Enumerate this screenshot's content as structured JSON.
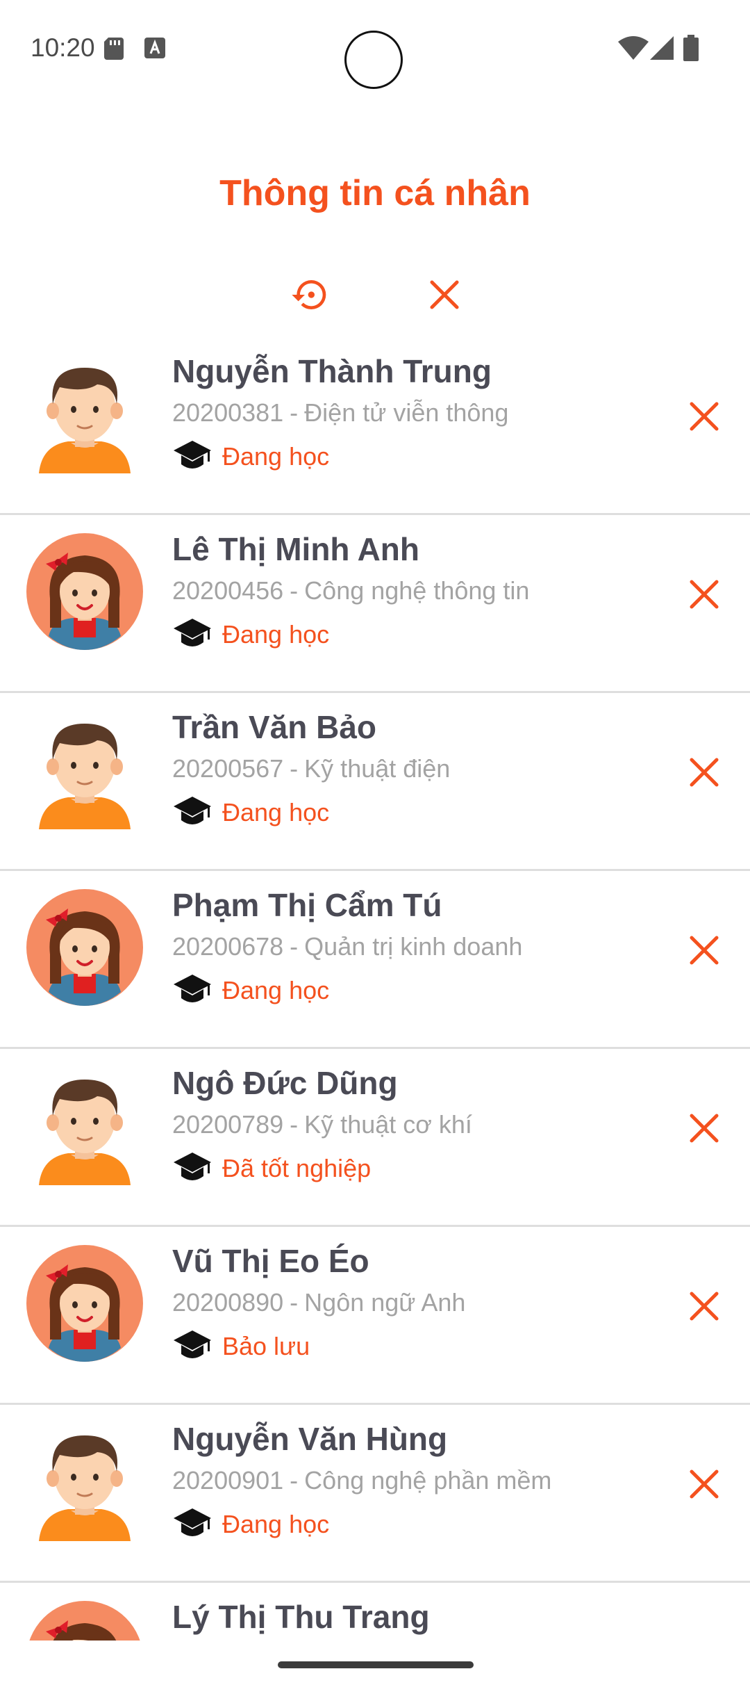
{
  "status_bar": {
    "time": "10:20"
  },
  "header": {
    "title": "Thông tin cá nhân"
  },
  "colors": {
    "accent": "#f4511e",
    "name": "#4a4a55",
    "subtext": "#a3a3a3",
    "divider": "#dedede"
  },
  "students": [
    {
      "name": "Nguyễn Thành Trung",
      "id": "20200381",
      "major": "Điện tử viễn thông",
      "status": "Đang học",
      "avatar": "male-avatar-icon"
    },
    {
      "name": "Lê Thị Minh Anh",
      "id": "20200456",
      "major": "Công nghệ thông tin",
      "status": "Đang học",
      "avatar": "female-avatar-icon"
    },
    {
      "name": "Trần Văn Bảo",
      "id": "20200567",
      "major": "Kỹ thuật điện",
      "status": "Đang học",
      "avatar": "male-avatar-icon"
    },
    {
      "name": "Phạm Thị Cẩm Tú",
      "id": "20200678",
      "major": "Quản trị kinh doanh",
      "status": "Đang học",
      "avatar": "female-avatar-icon"
    },
    {
      "name": "Ngô Đức Dũng",
      "id": "20200789",
      "major": "Kỹ thuật cơ khí",
      "status": "Đã tốt nghiệp",
      "avatar": "male-avatar-icon"
    },
    {
      "name": "Vũ Thị Eo Éo",
      "id": "20200890",
      "major": "Ngôn ngữ Anh",
      "status": "Bảo lưu",
      "avatar": "female-avatar-icon"
    },
    {
      "name": "Nguyễn Văn Hùng",
      "id": "20200901",
      "major": "Công nghệ phần mềm",
      "status": "Đang học",
      "avatar": "male-avatar-icon"
    },
    {
      "name": "Lý Thị Thu Trang",
      "avatar": "female-avatar-icon"
    }
  ],
  "sub_separator": "-"
}
